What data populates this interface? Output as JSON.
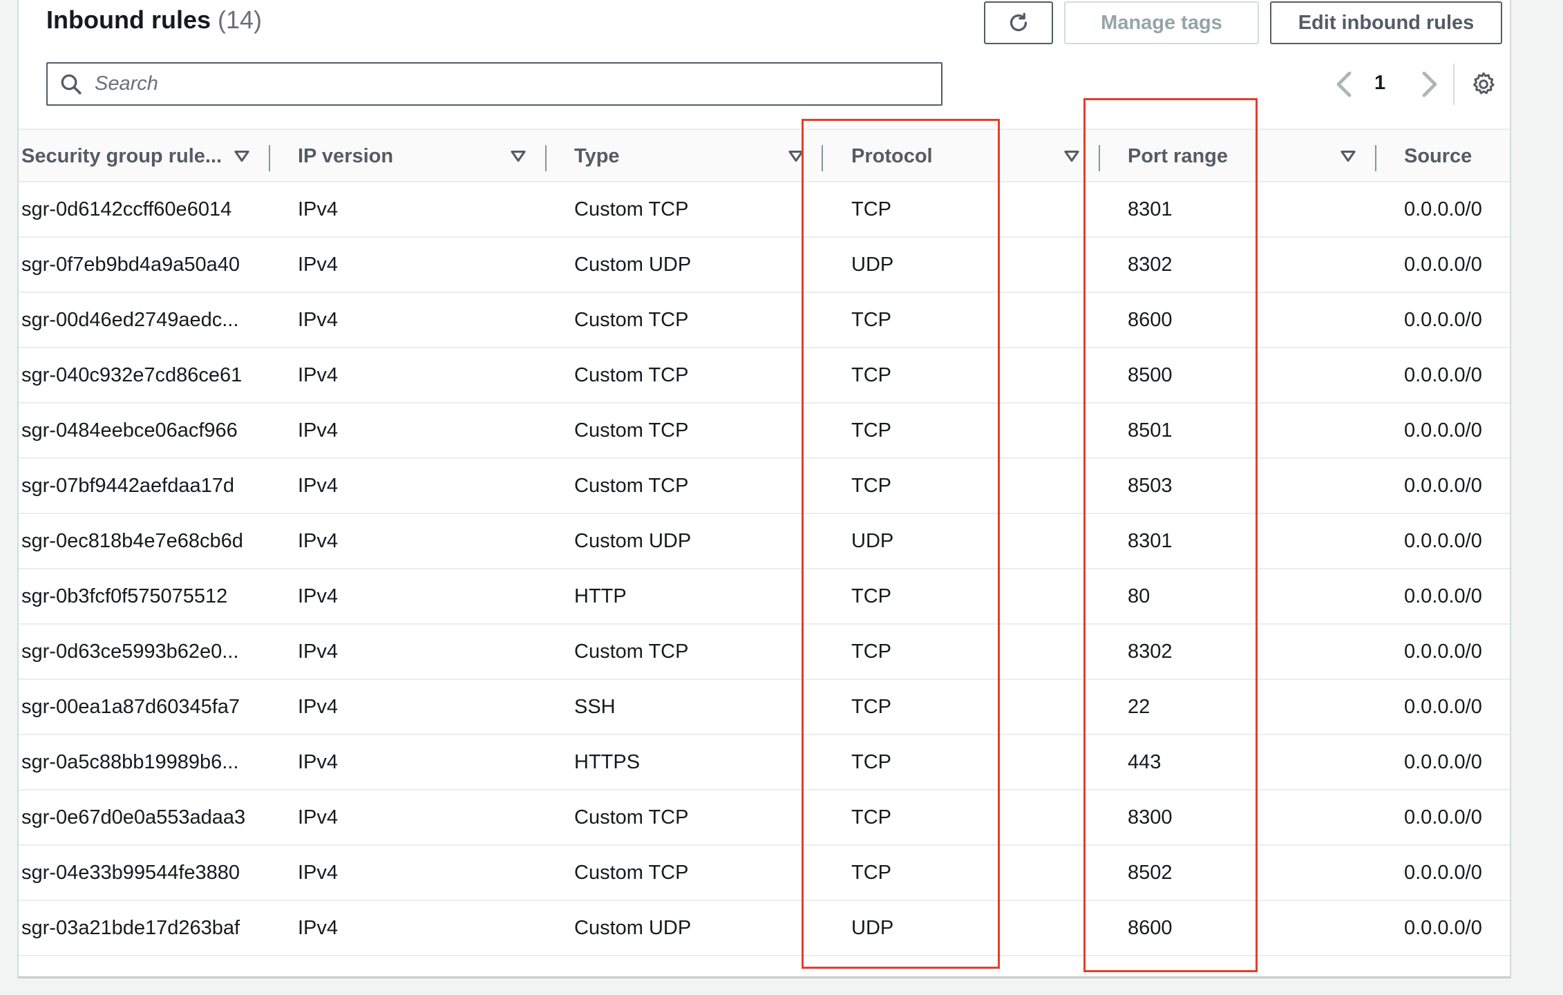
{
  "header": {
    "title": "Inbound rules",
    "count": "(14)",
    "manage_tags_label": "Manage tags",
    "edit_label": "Edit inbound rules"
  },
  "search": {
    "placeholder": "Search"
  },
  "pagination": {
    "current_page": "1"
  },
  "table": {
    "columns": [
      "Security group rule...",
      "IP version",
      "Type",
      "Protocol",
      "Port range",
      "Source"
    ],
    "rows": [
      [
        "sgr-0d6142ccff60e6014",
        "IPv4",
        "Custom TCP",
        "TCP",
        "8301",
        "0.0.0.0/0"
      ],
      [
        "sgr-0f7eb9bd4a9a50a40",
        "IPv4",
        "Custom UDP",
        "UDP",
        "8302",
        "0.0.0.0/0"
      ],
      [
        "sgr-00d46ed2749aedc...",
        "IPv4",
        "Custom TCP",
        "TCP",
        "8600",
        "0.0.0.0/0"
      ],
      [
        "sgr-040c932e7cd86ce61",
        "IPv4",
        "Custom TCP",
        "TCP",
        "8500",
        "0.0.0.0/0"
      ],
      [
        "sgr-0484eebce06acf966",
        "IPv4",
        "Custom TCP",
        "TCP",
        "8501",
        "0.0.0.0/0"
      ],
      [
        "sgr-07bf9442aefdaa17d",
        "IPv4",
        "Custom TCP",
        "TCP",
        "8503",
        "0.0.0.0/0"
      ],
      [
        "sgr-0ec818b4e7e68cb6d",
        "IPv4",
        "Custom UDP",
        "UDP",
        "8301",
        "0.0.0.0/0"
      ],
      [
        "sgr-0b3fcf0f575075512",
        "IPv4",
        "HTTP",
        "TCP",
        "80",
        "0.0.0.0/0"
      ],
      [
        "sgr-0d63ce5993b62e0...",
        "IPv4",
        "Custom TCP",
        "TCP",
        "8302",
        "0.0.0.0/0"
      ],
      [
        "sgr-00ea1a87d60345fa7",
        "IPv4",
        "SSH",
        "TCP",
        "22",
        "0.0.0.0/0"
      ],
      [
        "sgr-0a5c88bb19989b6...",
        "IPv4",
        "HTTPS",
        "TCP",
        "443",
        "0.0.0.0/0"
      ],
      [
        "sgr-0e67d0e0a553adaa3",
        "IPv4",
        "Custom TCP",
        "TCP",
        "8300",
        "0.0.0.0/0"
      ],
      [
        "sgr-04e33b99544fe3880",
        "IPv4",
        "Custom TCP",
        "TCP",
        "8502",
        "0.0.0.0/0"
      ],
      [
        "sgr-03a21bde17d263baf",
        "IPv4",
        "Custom UDP",
        "UDP",
        "8600",
        "0.0.0.0/0"
      ]
    ]
  },
  "icons": {
    "refresh": "refresh-icon",
    "search": "search-icon",
    "prev": "chevron-left-icon",
    "next": "chevron-right-icon",
    "settings": "gear-icon",
    "sort": "sort-caret-icon"
  },
  "colors": {
    "highlight": "#e53e29",
    "border": "#545b64",
    "disabled_text": "#95a5a6"
  }
}
